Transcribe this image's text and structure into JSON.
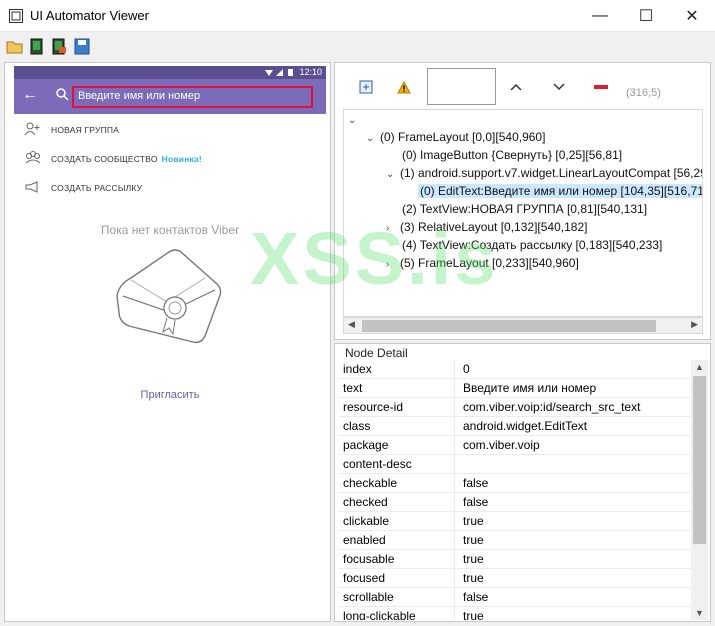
{
  "window": {
    "title": "UI Automator Viewer",
    "minimize": "—",
    "maximize": "☐",
    "close": "✕"
  },
  "phone": {
    "time": "12:10",
    "search_text": "Введите имя или номер",
    "menu": [
      {
        "label": "НОВАЯ ГРУППА",
        "icon": "group-add-icon"
      },
      {
        "label": "СОЗДАТЬ СООБЩЕСТВО",
        "badge": "Новинка!",
        "icon": "community-icon"
      },
      {
        "label": "СОЗДАТЬ РАССЫЛКУ",
        "icon": "broadcast-icon"
      }
    ],
    "empty": "Пока нет контактов Viber",
    "invite": "Пригласить"
  },
  "inspector": {
    "coords": "(316,5)",
    "tree": [
      {
        "text": "(0) FrameLayout [0,0][540,960]"
      },
      {
        "text": "(0) ImageButton {Свернуть} [0,25][56,81]"
      },
      {
        "text": "(1) android.support.v7.widget.LinearLayoutCompat [56,29"
      },
      {
        "text": "(0) EditText:Введите имя или номер [104,35][516,71]"
      },
      {
        "text": "(2) TextView:НОВАЯ ГРУППА [0,81][540,131]"
      },
      {
        "text": "(3) RelativeLayout [0,132][540,182]"
      },
      {
        "text": "(4) TextView:Создать рассылку [0,183][540,233]"
      },
      {
        "text": "(5) FrameLayout [0,233][540,960]"
      }
    ]
  },
  "node_detail": {
    "title": "Node Detail",
    "rows": [
      {
        "key": "index",
        "value": "0"
      },
      {
        "key": "text",
        "value": "Введите имя или номер"
      },
      {
        "key": "resource-id",
        "value": "com.viber.voip:id/search_src_text"
      },
      {
        "key": "class",
        "value": "android.widget.EditText"
      },
      {
        "key": "package",
        "value": "com.viber.voip"
      },
      {
        "key": "content-desc",
        "value": ""
      },
      {
        "key": "checkable",
        "value": "false"
      },
      {
        "key": "checked",
        "value": "false"
      },
      {
        "key": "clickable",
        "value": "true"
      },
      {
        "key": "enabled",
        "value": "true"
      },
      {
        "key": "focusable",
        "value": "true"
      },
      {
        "key": "focused",
        "value": "true"
      },
      {
        "key": "scrollable",
        "value": "false"
      },
      {
        "key": "long-clickable",
        "value": "true"
      }
    ]
  },
  "watermark": "XSS.is",
  "colors": {
    "appbar": "#7b6bb8",
    "statusbar": "#5b4f8f",
    "highlight": "#e0103a",
    "selection": "#cce8ff"
  }
}
